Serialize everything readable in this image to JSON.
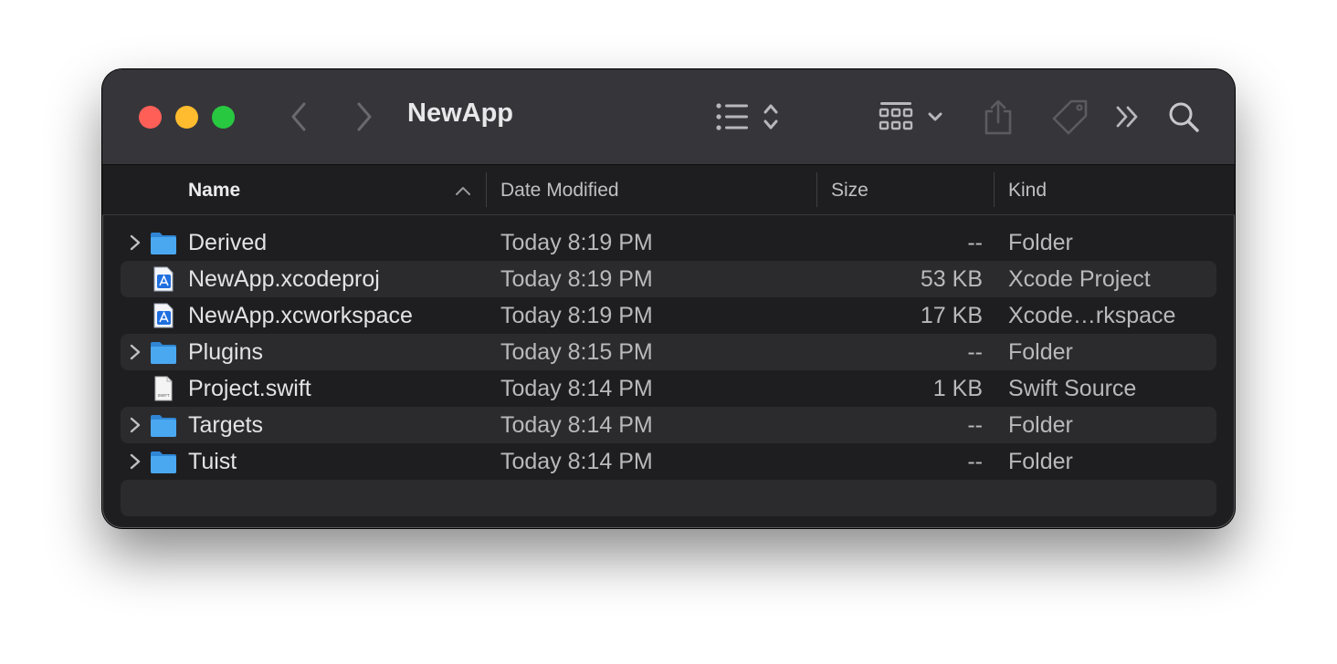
{
  "window": {
    "title": "NewApp",
    "traffic_lights": {
      "close": "#ff5f57",
      "minimize": "#febc2e",
      "zoom": "#28c840"
    },
    "toolbar": {
      "back_icon": "chevron-left-icon",
      "forward_icon": "chevron-right-icon",
      "view_icon": "list-view-icon",
      "group_icon": "grid-group-icon",
      "share_icon": "share-icon",
      "tag_icon": "tag-icon",
      "more_icon": "double-chevron-right-icon",
      "search_icon": "search-icon"
    }
  },
  "columns": {
    "name": "Name",
    "date": "Date Modified",
    "size": "Size",
    "kind": "Kind"
  },
  "files": [
    {
      "name": "Derived",
      "date": "Today 8:19 PM",
      "size": "--",
      "kind": "Folder",
      "type": "folder"
    },
    {
      "name": "NewApp.xcodeproj",
      "date": "Today 8:19 PM",
      "size": "53 KB",
      "kind": "Xcode Project",
      "type": "xcode"
    },
    {
      "name": "NewApp.xcworkspace",
      "date": "Today 8:19 PM",
      "size": "17 KB",
      "kind": "Xcode…rkspace",
      "type": "xcode"
    },
    {
      "name": "Plugins",
      "date": "Today 8:15 PM",
      "size": "--",
      "kind": "Folder",
      "type": "folder"
    },
    {
      "name": "Project.swift",
      "date": "Today 8:14 PM",
      "size": "1 KB",
      "kind": "Swift Source",
      "type": "swift"
    },
    {
      "name": "Targets",
      "date": "Today 8:14 PM",
      "size": "--",
      "kind": "Folder",
      "type": "folder"
    },
    {
      "name": "Tuist",
      "date": "Today 8:14 PM",
      "size": "--",
      "kind": "Folder",
      "type": "folder"
    }
  ],
  "swift_icon_label": "SWIFT",
  "colors": {
    "folder": "#4aa8f0",
    "window_bg": "#1e1e20",
    "titlebar": "#36363a"
  }
}
